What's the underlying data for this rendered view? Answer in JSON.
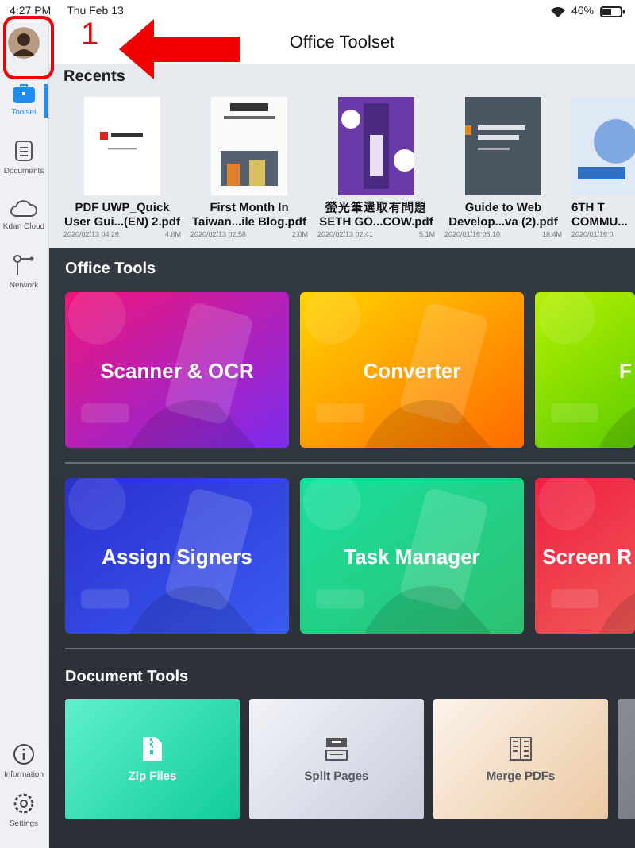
{
  "status_bar": {
    "time": "4:27 PM",
    "date": "Thu Feb 13",
    "battery": "46%"
  },
  "header": {
    "title": "Office Toolset"
  },
  "annotation": {
    "number": "1"
  },
  "sidebar": {
    "top_items": [
      {
        "label": "Toolset",
        "selected": true
      },
      {
        "label": "Documents",
        "selected": false
      },
      {
        "label": "Kdan Cloud",
        "selected": false
      },
      {
        "label": "Network",
        "selected": false
      }
    ],
    "bottom_items": [
      {
        "label": "Information",
        "selected": false
      },
      {
        "label": "Settings",
        "selected": false
      }
    ]
  },
  "recents": {
    "title": "Recents",
    "files": [
      {
        "name": "PDF UWP_Quick\nUser Gui...(EN) 2.pdf",
        "date": "2020/02/13 04:26",
        "size": "4.8M"
      },
      {
        "name": "First Month In\nTaiwan...ile Blog.pdf",
        "date": "2020/02/13 02:58",
        "size": "2.0M"
      },
      {
        "name": "螢光筆選取有問題\nSETH GO...COW.pdf",
        "date": "2020/02/13 02:41",
        "size": "5.1M"
      },
      {
        "name": "Guide to Web\nDevelop...va (2).pdf",
        "date": "2020/01/16 05:10",
        "size": "18.4M"
      },
      {
        "name": "6TH T\nCOMMU...",
        "date": "2020/01/16 0"
      }
    ]
  },
  "office_tools": {
    "title": "Office Tools",
    "rows": [
      [
        {
          "label": "Scanner & OCR"
        },
        {
          "label": "Converter"
        },
        {
          "label": "F"
        }
      ],
      [
        {
          "label": "Assign Signers"
        },
        {
          "label": "Task Manager"
        },
        {
          "label": "Screen R"
        }
      ]
    ]
  },
  "document_tools": {
    "title": "Document Tools",
    "tiles": [
      {
        "kind": "tool",
        "label": "Zip Files"
      },
      {
        "kind": "tool",
        "label": "Split Pages"
      },
      {
        "kind": "tool",
        "label": "Merge PDFs"
      },
      {
        "kind": "blank"
      }
    ]
  }
}
